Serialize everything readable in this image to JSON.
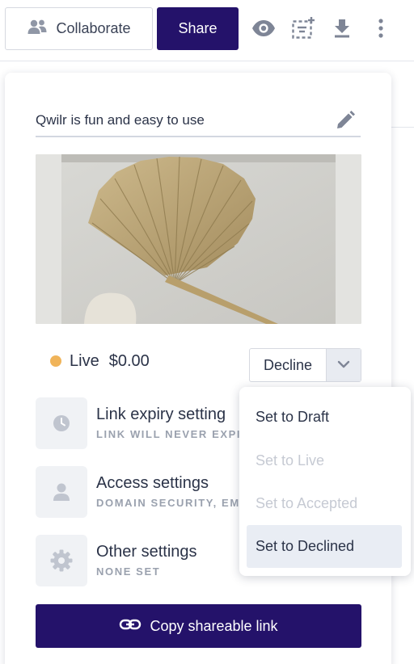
{
  "toolbar": {
    "collaborate_label": "Collaborate",
    "share_label": "Share",
    "icons": [
      "people-icon",
      "eye-icon",
      "add-block-icon",
      "download-icon",
      "more-vertical-icon"
    ]
  },
  "page": {
    "title": "Qwilr is fun and easy to use",
    "status": {
      "label": "Live",
      "color": "#f0b45a",
      "amount": "$0.00"
    },
    "action": {
      "label": "Decline"
    },
    "settings": [
      {
        "name": "Link expiry setting",
        "sub": "LINK WILL NEVER EXPI",
        "icon": "clock-icon"
      },
      {
        "name": "Access settings",
        "sub": "DOMAIN SECURITY, EM",
        "icon": "person-icon"
      },
      {
        "name": "Other settings",
        "sub": "NONE SET",
        "icon": "gear-icon"
      }
    ],
    "copy_link_label": "Copy shareable link"
  },
  "menu": {
    "items": [
      {
        "label": "Set to Draft",
        "state": "enabled"
      },
      {
        "label": "Set to Live",
        "state": "disabled"
      },
      {
        "label": "Set to Accepted",
        "state": "disabled"
      },
      {
        "label": "Set to Declined",
        "state": "selected"
      }
    ]
  },
  "colors": {
    "brand": "#24126a",
    "status_live": "#f0b45a"
  }
}
